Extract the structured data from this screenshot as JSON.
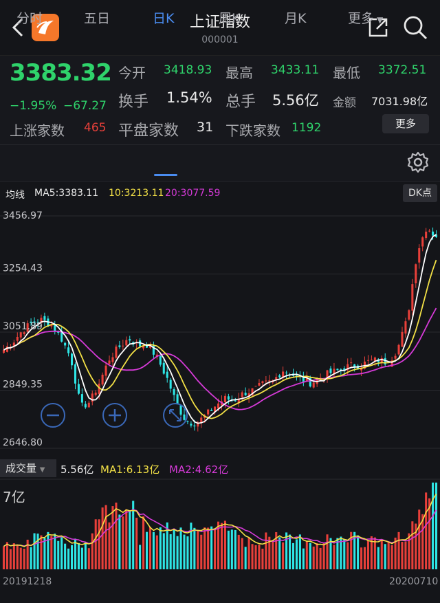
{
  "header": {
    "title": "上证指数",
    "code": "000001"
  },
  "quote": {
    "price": "3383.32",
    "change_pct": "−1.95%",
    "change_abs": "−67.27",
    "open_label": "今开",
    "open": "3418.93",
    "high_label": "最高",
    "high": "3433.11",
    "low_label": "最低",
    "low": "3372.51",
    "turnover_label": "换手",
    "turnover": "1.54%",
    "total_hand_label": "总手",
    "total_hand": "5.56亿",
    "amount_label": "金额",
    "amount": "7031.98亿",
    "up_label": "上涨家数",
    "up": "465",
    "flat_label": "平盘家数",
    "flat": "31",
    "down_label": "下跌家数",
    "down": "1192",
    "more_button": "更多"
  },
  "tabs": [
    "分时",
    "五日",
    "日K",
    "周K",
    "月K",
    "更多"
  ],
  "active_tab": "日K",
  "ma_bar": {
    "label": "均线",
    "ma5": "MA5:3383.11",
    "ma10": "10:3213.11",
    "ma20": "20:3077.59",
    "dk_button": "DK点"
  },
  "volume_bar": {
    "selector": "成交量",
    "vol": "5.56亿",
    "ma1": "MA1:6.13亿",
    "ma2": "MA2:4.62亿",
    "axis_max": "7亿"
  },
  "dates": {
    "start": "20191218",
    "end": "20200710"
  },
  "colors": {
    "up": "#e8403a",
    "down": "#2ee6e6",
    "ma5": "#ffffff",
    "ma10": "#f2e046",
    "ma20": "#d63ad8",
    "accent": "#4a8cf0"
  },
  "chart_data": {
    "type": "candlestick",
    "ylim": [
      2646.8,
      3456.97
    ],
    "y_ticks": [
      "3456.97",
      "3254.43",
      "3051.89",
      "2849.35",
      "2646.80"
    ],
    "x_labels": [
      "20191218",
      "20200710"
    ],
    "volume_ylim": [
      0,
      7
    ],
    "volume_unit": "亿",
    "anchor_closes": [
      2990,
      3020,
      3060,
      3085,
      3095,
      3075,
      3030,
      2960,
      2790,
      2810,
      2880,
      2960,
      3000,
      3030,
      3005,
      3010,
      2960,
      2890,
      2800,
      2740,
      2735,
      2760,
      2795,
      2820,
      2815,
      2840,
      2850,
      2870,
      2880,
      2920,
      2905,
      2885,
      2875,
      2895,
      2910,
      2920,
      2935,
      2935,
      2950,
      2955,
      2945,
      2995,
      3100,
      3330,
      3420,
      3383
    ],
    "series": [
      {
        "name": "MA5",
        "last": 3383.11
      },
      {
        "name": "10",
        "last": 3213.11
      },
      {
        "name": "20",
        "last": 3077.59
      }
    ]
  }
}
